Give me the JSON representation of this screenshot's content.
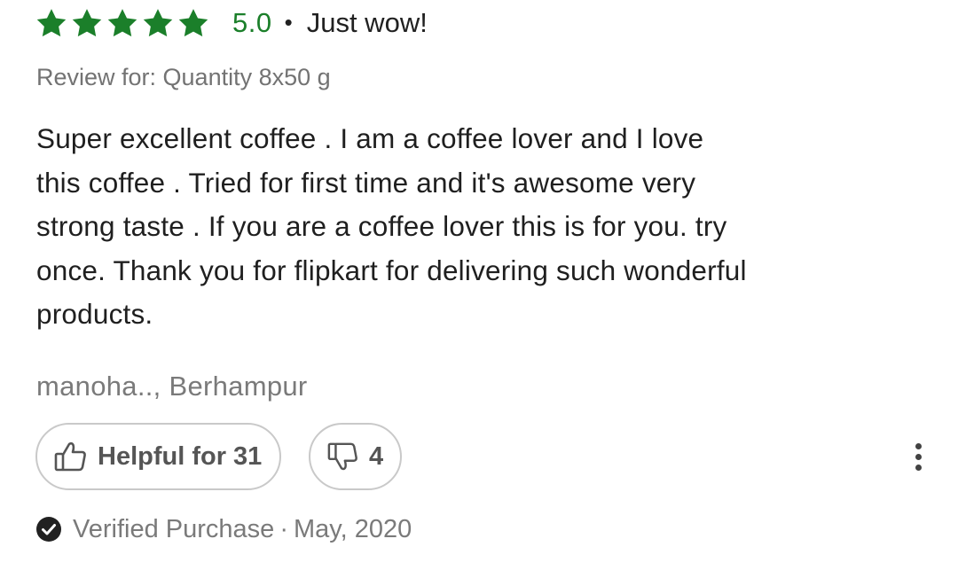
{
  "rating": {
    "stars_filled": 5,
    "stars_total": 5,
    "value": "5.0",
    "separator": "•",
    "title": "Just wow!",
    "star_color": "#1b7f2a"
  },
  "variant": "Review for: Quantity 8x50 g",
  "body": "Super excellent coffee . I am a coffee  lover and I love\nthis coffee . Tried for first time and it's awesome very\nstrong taste . If you are a coffee lover this is for you.  try\nonce. Thank you for flipkart for delivering  such wonderful\nproducts.",
  "author": "manoha.., Berhampur",
  "actions": {
    "helpful_label": "Helpful for 31",
    "unhelpful_count": "4",
    "helpful_icon": "thumbs-up-icon",
    "unhelpful_icon": "thumbs-down-icon",
    "more_icon": "more-vertical-icon"
  },
  "verified": {
    "label": "Verified Purchase",
    "separator": "·",
    "date": "May, 2020",
    "icon": "check-circle-icon"
  }
}
